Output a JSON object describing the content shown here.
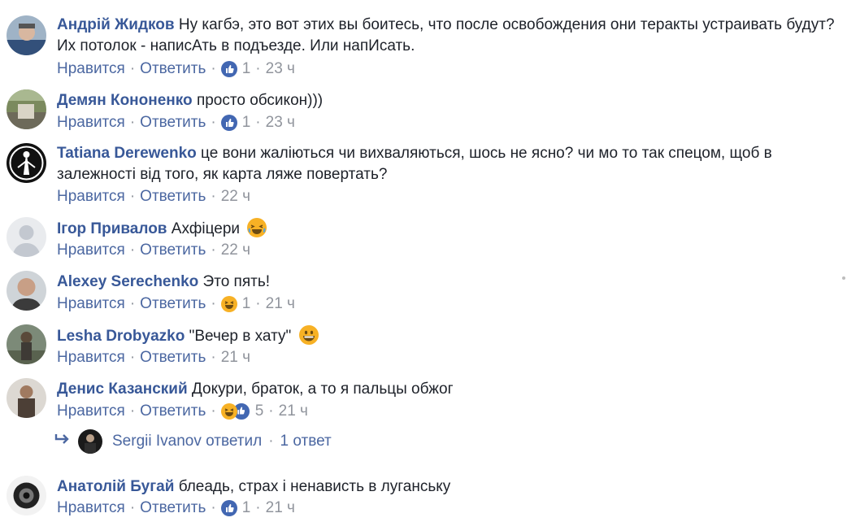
{
  "colors": {
    "author": "#385898",
    "link": "#4b67a1",
    "muted": "#90949c",
    "like": "#4267b2",
    "haha": "#f7b125"
  },
  "comments": [
    {
      "author": "Андрій Жидков",
      "text_line1": "Ну кагбэ, это вот этих вы боитесь, что после освобождения они теракты устраивать будут?",
      "text_line2": "Их потолок - написАть в подъезде. Или напИсать.",
      "like": "Нравится",
      "reply": "Ответить",
      "reaction_count": "1",
      "time": "23 ч",
      "reaction_icon": "like-icon"
    },
    {
      "author": "Демян Кононенко",
      "text_line1": "просто обсикон)))",
      "like": "Нравится",
      "reply": "Ответить",
      "reaction_count": "1",
      "time": "23 ч",
      "reaction_icon": "like-icon"
    },
    {
      "author": "Tatiana Derewenko",
      "text_line1": "це вони жаліються чи вихваляються, шось не ясно? чи мо то так спецом, щоб в",
      "text_line2": "залежності від того, як карта ляже повертать?",
      "like": "Нравится",
      "reply": "Ответить",
      "time": "22 ч"
    },
    {
      "author": "Ігор Привалов",
      "text_line1": "Ахфіцери",
      "inline_emoji": "laughing-emoji-icon",
      "like": "Нравится",
      "reply": "Ответить",
      "time": "22 ч"
    },
    {
      "author": "Alexey Serechenko",
      "text_line1": "Это пять!",
      "like": "Нравится",
      "reply": "Ответить",
      "reaction_count": "1",
      "time": "21 ч",
      "reaction_icon": "haha-icon"
    },
    {
      "author": "Lesha Drobyazko",
      "text_line1": "\"Вечер в хату\"",
      "inline_emoji": "grinning-emoji-icon",
      "like": "Нравится",
      "reply": "Ответить",
      "time": "21 ч"
    },
    {
      "author": "Денис Казанский",
      "text_line1": "Докури, браток, а то я пальцы обжог",
      "like": "Нравится",
      "reply": "Ответить",
      "reaction_count": "5",
      "time": "21 ч",
      "reaction_icon": "haha-like-icons"
    },
    {
      "author": "Анатолій Бугай",
      "text_line1": "блеадь, страх і ненависть в луганську",
      "like": "Нравится",
      "reply": "Ответить",
      "reaction_count": "1",
      "time": "21 ч",
      "reaction_icon": "like-icon"
    }
  ],
  "reply_thread": {
    "author_reply": "Sergii Ivanov ответил",
    "count": "1 ответ"
  },
  "sep": "·"
}
